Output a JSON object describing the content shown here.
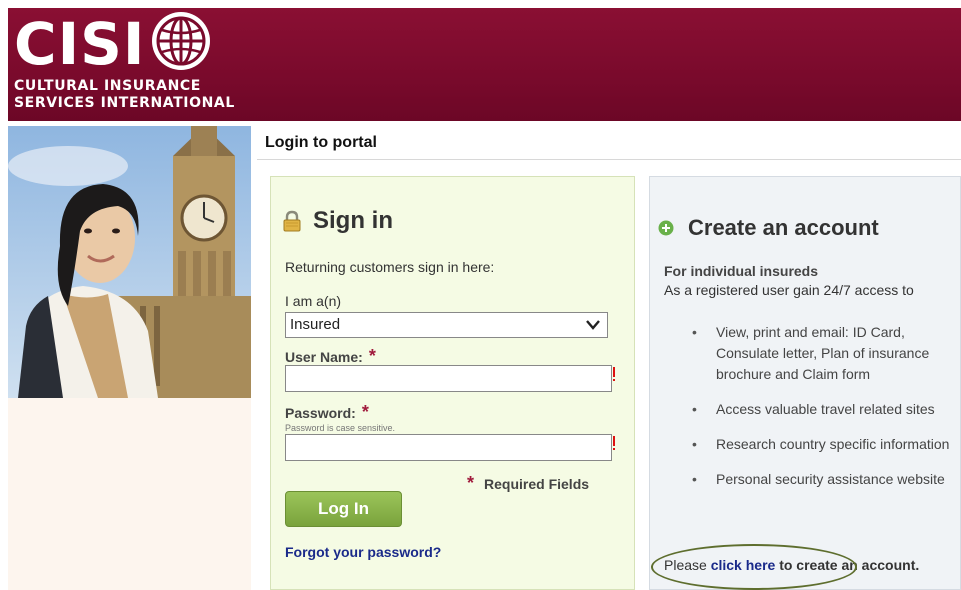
{
  "brand": {
    "logo_text": "CISI",
    "subtitle_line1": "CULTURAL INSURANCE",
    "subtitle_line2": "SERVICES INTERNATIONAL",
    "color": "#7a0a2c"
  },
  "portal": {
    "title": "Login to portal"
  },
  "signin": {
    "title": "Sign in",
    "intro": "Returning customers sign in here:",
    "role_label": "I am a(n)",
    "role_value": "Insured",
    "username_label": "User Name:",
    "password_label": "Password:",
    "password_hint": "Password is case sensitive.",
    "required_star": "*",
    "required_text": "Required Fields",
    "login_button": "Log In",
    "forgot_link": "Forgot your password?",
    "accent": "#7aa33c"
  },
  "create": {
    "title": "Create an account",
    "subtitle": "For individual insureds",
    "description": "As a registered user gain 24/7 access to",
    "bullets": [
      "View, print and email: ID Card, Consulate letter, Plan of insurance brochure and Claim form",
      "Access valuable travel related sites",
      "Research country specific information",
      "Personal security assistance website"
    ],
    "footer_prefix": "Please ",
    "footer_link": "click here",
    "footer_suffix": " to create an account."
  },
  "icons": {
    "globe": "globe-icon",
    "lock": "lock-icon",
    "plus": "plus-circle-icon",
    "chevron": "chevron-down-icon"
  }
}
